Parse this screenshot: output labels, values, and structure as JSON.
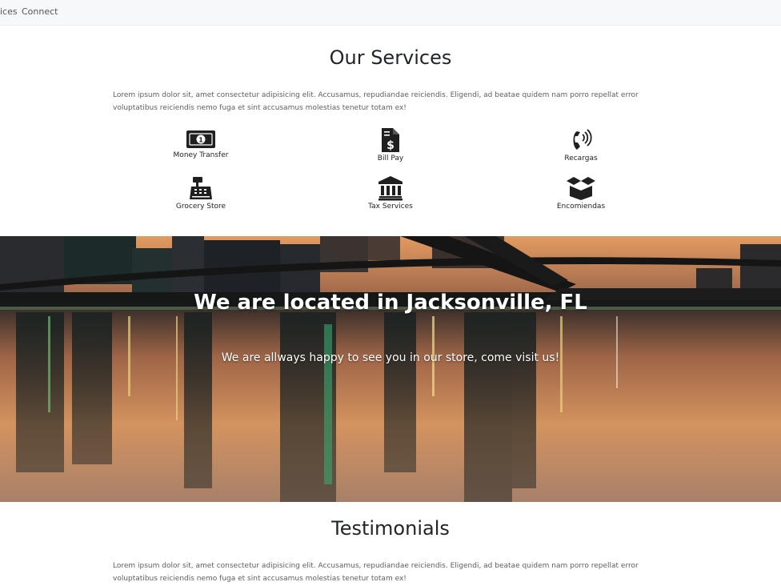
{
  "nav": {
    "items": [
      "ices",
      "Connect"
    ]
  },
  "services": {
    "title": "Our Services",
    "text": "Lorem ipsum dolor sit, amet consectetur adipisicing elit. Accusamus, repudiandae reiciendis. Eligendi, ad beatae quidem nam porro repellat error voluptatibus reiciendis nemo fuga et sint accusamus molestias tenetur totam ex!",
    "items": [
      {
        "label": "Money Transfer",
        "icon": "money-bill-icon"
      },
      {
        "label": "Bill Pay",
        "icon": "file-invoice-dollar-icon"
      },
      {
        "label": "Recargas",
        "icon": "phone-volume-icon"
      },
      {
        "label": "Grocery Store",
        "icon": "cash-register-icon"
      },
      {
        "label": "Tax Services",
        "icon": "landmark-icon"
      },
      {
        "label": "Encomiendas",
        "icon": "box-open-icon"
      }
    ]
  },
  "location": {
    "heading": "We are located in Jacksonville, FL",
    "subtext": "We are allways happy to see you in our store, come visit us!"
  },
  "testimonials": {
    "title": "Testimonials",
    "text": "Lorem ipsum dolor sit, amet consectetur adipisicing elit. Accusamus, repudiandae reiciendis. Eligendi, ad beatae quidem nam porro repellat error voluptatibus reiciendis nemo fuga et sint accusamus molestias tenetur totam ex!"
  }
}
